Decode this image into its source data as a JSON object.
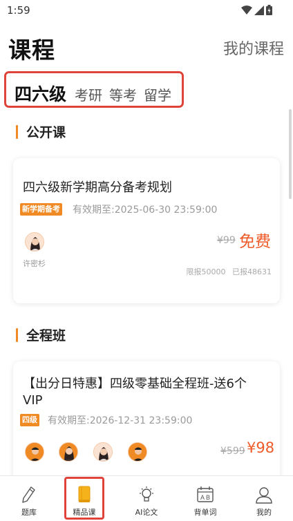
{
  "status": {
    "time": "1:59"
  },
  "header": {
    "title": "课程",
    "my_courses": "我的课程"
  },
  "tabs": [
    {
      "label": "四六级",
      "active": true
    },
    {
      "label": "考研",
      "active": false
    },
    {
      "label": "等考",
      "active": false
    },
    {
      "label": "留学",
      "active": false
    }
  ],
  "sections": {
    "public": {
      "title": "公开课",
      "course": {
        "title": "四六级新学期高分备考规划",
        "tag": "新学期备考",
        "valid": "有效期至:2025-06-30 23:59:00",
        "teacher": "许密杉",
        "old_price": "¥99",
        "price": "免费",
        "limit": "限报50000",
        "enrolled": "已报48631"
      }
    },
    "full": {
      "title": "全程班",
      "course": {
        "title": "【出分日特惠】四级零基础全程班-送6个VIP",
        "tag": "四级",
        "valid": "有效期至:2026-12-31 23:59:00",
        "old_price": "¥599",
        "price": "¥98"
      }
    }
  },
  "tabbar": [
    {
      "label": "题库",
      "icon": "pencil-icon"
    },
    {
      "label": "精品课",
      "icon": "book-icon",
      "active": true
    },
    {
      "label": "AI论文",
      "icon": "lightbulb-icon"
    },
    {
      "label": "背单词",
      "icon": "calendar-icon"
    },
    {
      "label": "我的",
      "icon": "user-icon"
    }
  ],
  "colors": {
    "accent": "#f08a24",
    "price": "#ef5a29",
    "highlight": "#e0433a"
  }
}
